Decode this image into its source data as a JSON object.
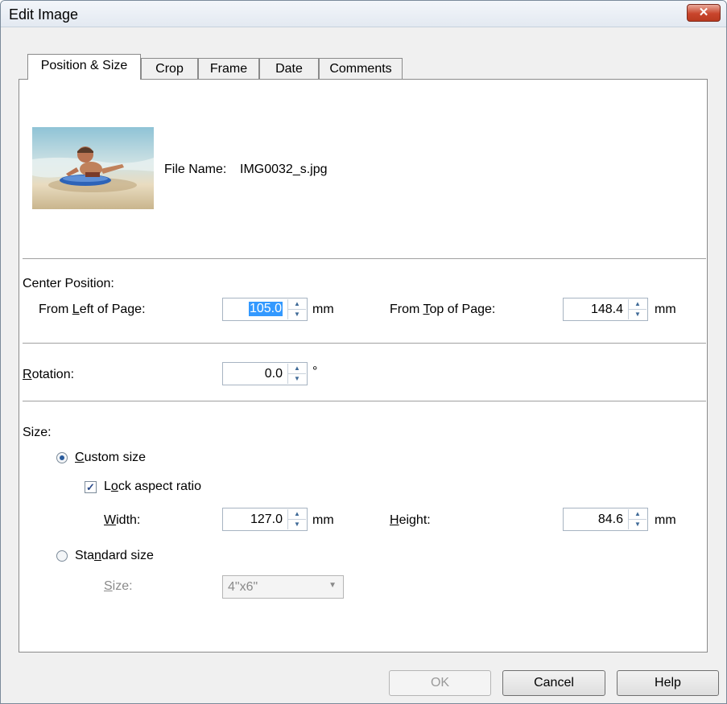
{
  "window": {
    "title": "Edit Image",
    "close_glyph": "✕"
  },
  "tabs": [
    {
      "label": "Position & Size",
      "active": true
    },
    {
      "label": "Crop",
      "active": false
    },
    {
      "label": "Frame",
      "active": false
    },
    {
      "label": "Date",
      "active": false
    },
    {
      "label": "Comments",
      "active": false
    }
  ],
  "file": {
    "label": "File Name:",
    "name": "IMG0032_s.jpg"
  },
  "center_position": {
    "heading": "Center Position:",
    "left_label_pre": "From ",
    "left_label_accel": "L",
    "left_label_post": "eft of Page:",
    "left_value": "105.0",
    "left_unit": "mm",
    "top_label_pre": "From ",
    "top_label_accel": "T",
    "top_label_post": "op of Page:",
    "top_value": "148.4",
    "top_unit": "mm"
  },
  "rotation": {
    "label_accel": "R",
    "label_post": "otation:",
    "value": "0.0",
    "unit": "°"
  },
  "size": {
    "heading": "Size:",
    "custom_accel": "C",
    "custom_post": "ustom size",
    "custom_selected": true,
    "lock_pre": "L",
    "lock_accel": "o",
    "lock_post": "ck aspect ratio",
    "lock_checked": true,
    "width_accel": "W",
    "width_post": "idth:",
    "width_value": "127.0",
    "width_unit": "mm",
    "height_accel": "H",
    "height_post": "eight:",
    "height_value": "84.6",
    "height_unit": "mm",
    "standard_pre": "Sta",
    "standard_accel": "n",
    "standard_post": "dard size",
    "standard_selected": false,
    "std_size_accel": "S",
    "std_size_post": "ize:",
    "std_size_value": "4\"x6\""
  },
  "buttons": {
    "ok": "OK",
    "cancel": "Cancel",
    "help": "Help"
  },
  "icons": {
    "close": "close-icon",
    "spin_up": "▲",
    "spin_down": "▼",
    "dropdown": "▼",
    "check": "✓"
  }
}
